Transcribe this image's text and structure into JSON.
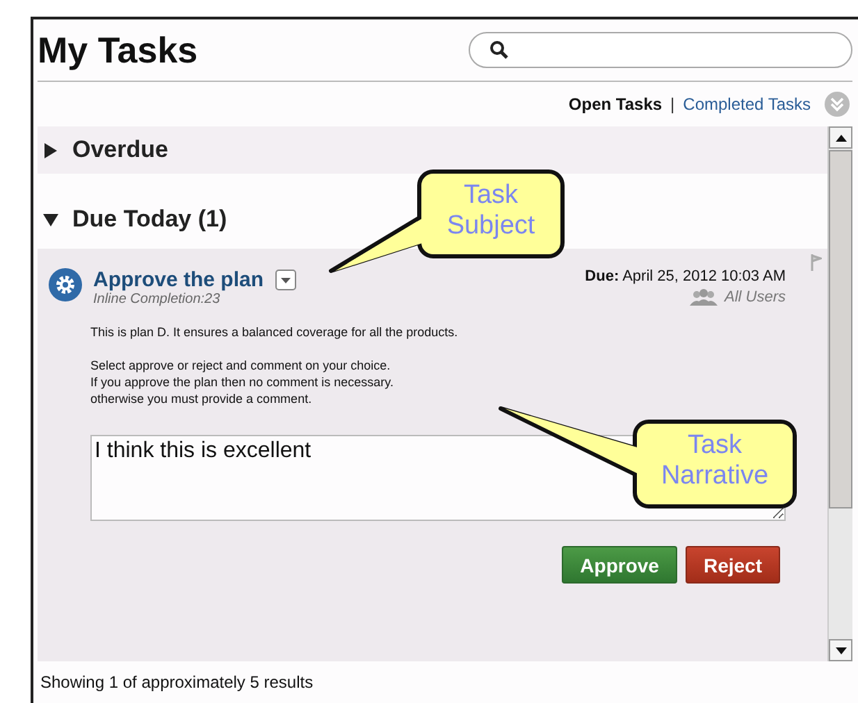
{
  "title": "My Tasks",
  "tabs": [
    {
      "label": "Open Tasks",
      "selected": true
    },
    {
      "label": "Completed Tasks",
      "selected": false
    }
  ],
  "tab_separator": "|",
  "sections": [
    {
      "title": "Overdue",
      "expanded": false
    },
    {
      "title": "Due Today (1)",
      "expanded": true,
      "tasks": [
        {
          "subject": "Approve the plan",
          "subtitle": "Inline Completion:23",
          "due_label": "Due:",
          "due_value": "April 25, 2012 10:03 AM",
          "assignee": "All Users",
          "narrative": [
            "This is plan D. It ensures a balanced coverage for all the products.",
            "Select approve or reject and comment on your choice.\nIf you approve the plan then no comment is necessary.\notherwise you must provide a comment."
          ],
          "comment": "I think this is excellent",
          "buttons": [
            {
              "label": "Approve",
              "kind": "approve"
            },
            {
              "label": "Reject",
              "kind": "reject"
            }
          ]
        }
      ]
    }
  ],
  "footer": "Showing 1 of approximately 5 results",
  "callouts": [
    {
      "text": "Task Subject"
    },
    {
      "text": "Task Narrative"
    }
  ]
}
